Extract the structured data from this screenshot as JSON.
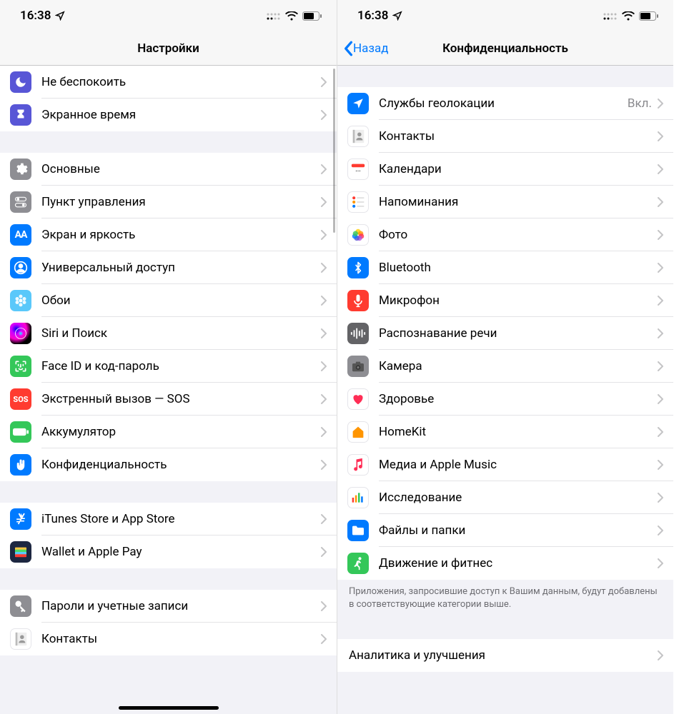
{
  "statusbar": {
    "time": "16:38"
  },
  "left": {
    "title": "Настройки",
    "groups": [
      {
        "items": [
          {
            "id": "dnd",
            "label": "Не беспокоить",
            "icon": "moon",
            "bg": "bg-purple"
          },
          {
            "id": "screentime",
            "label": "Экранное время",
            "icon": "hourglass",
            "bg": "bg-purple"
          }
        ]
      },
      {
        "items": [
          {
            "id": "general",
            "label": "Основные",
            "icon": "gear",
            "bg": "bg-gray"
          },
          {
            "id": "controlcenter",
            "label": "Пункт управления",
            "icon": "switches",
            "bg": "bg-gray"
          },
          {
            "id": "display",
            "label": "Экран и яркость",
            "icon": "aa",
            "bg": "bg-blue"
          },
          {
            "id": "accessibility",
            "label": "Универсальный доступ",
            "icon": "person-circle",
            "bg": "bg-blue"
          },
          {
            "id": "wallpaper",
            "label": "Обои",
            "icon": "flower",
            "bg": "bg-lightblue"
          },
          {
            "id": "siri",
            "label": "Siri и Поиск",
            "icon": "siri",
            "bg": "bg-siri"
          },
          {
            "id": "faceid",
            "label": "Face ID и код-пароль",
            "icon": "faceid",
            "bg": "bg-green"
          },
          {
            "id": "sos",
            "label": "Экстренный вызов — SOS",
            "icon": "sos",
            "bg": "bg-red"
          },
          {
            "id": "battery",
            "label": "Аккумулятор",
            "icon": "battery",
            "bg": "bg-green"
          },
          {
            "id": "privacy",
            "label": "Конфиденциальность",
            "icon": "hand",
            "bg": "bg-blue"
          }
        ]
      },
      {
        "items": [
          {
            "id": "itunes",
            "label": "iTunes Store и App Store",
            "icon": "appstore",
            "bg": "bg-blue"
          },
          {
            "id": "wallet",
            "label": "Wallet и Apple Pay",
            "icon": "wallet",
            "bg": "bg-navy"
          }
        ]
      },
      {
        "items": [
          {
            "id": "passwords",
            "label": "Пароли и учетные записи",
            "icon": "key",
            "bg": "bg-gray"
          },
          {
            "id": "contacts",
            "label": "Контакты",
            "icon": "contacts",
            "bg": "bg-white"
          }
        ]
      }
    ]
  },
  "right": {
    "back": "Назад",
    "title": "Конфиденциальность",
    "groups": [
      {
        "items": [
          {
            "id": "location",
            "label": "Службы геолокации",
            "value": "Вкл.",
            "icon": "location",
            "bg": "bg-blue"
          },
          {
            "id": "contacts2",
            "label": "Контакты",
            "icon": "contacts",
            "bg": "bg-white"
          },
          {
            "id": "calendars",
            "label": "Календари",
            "icon": "calendar",
            "bg": "bg-white"
          },
          {
            "id": "reminders",
            "label": "Напоминания",
            "icon": "reminders",
            "bg": "bg-white"
          },
          {
            "id": "photos",
            "label": "Фото",
            "icon": "photos",
            "bg": "bg-white"
          },
          {
            "id": "bluetooth",
            "label": "Bluetooth",
            "icon": "bluetooth",
            "bg": "bg-blue"
          },
          {
            "id": "microphone",
            "label": "Микрофон",
            "icon": "mic",
            "bg": "bg-red"
          },
          {
            "id": "speech",
            "label": "Распознавание речи",
            "icon": "waveform",
            "bg": "bg-darkgray"
          },
          {
            "id": "camera",
            "label": "Камера",
            "icon": "camera",
            "bg": "bg-gray"
          },
          {
            "id": "health",
            "label": "Здоровье",
            "icon": "heart",
            "bg": "bg-white"
          },
          {
            "id": "homekit",
            "label": "HomeKit",
            "icon": "home",
            "bg": "bg-white"
          },
          {
            "id": "media",
            "label": "Медиа и Apple Music",
            "icon": "music",
            "bg": "bg-white"
          },
          {
            "id": "research",
            "label": "Исследование",
            "icon": "bars",
            "bg": "bg-white"
          },
          {
            "id": "files",
            "label": "Файлы и папки",
            "icon": "folder",
            "bg": "bg-blue"
          },
          {
            "id": "motion",
            "label": "Движение и фитнес",
            "icon": "running",
            "bg": "bg-green"
          }
        ],
        "footer": "Приложения, запросившие доступ к Вашим данным, будут добавлены в соответствующие категории выше."
      },
      {
        "items": [
          {
            "id": "analytics",
            "label": "Аналитика и улучшения",
            "icon": "",
            "bg": ""
          }
        ]
      }
    ]
  }
}
